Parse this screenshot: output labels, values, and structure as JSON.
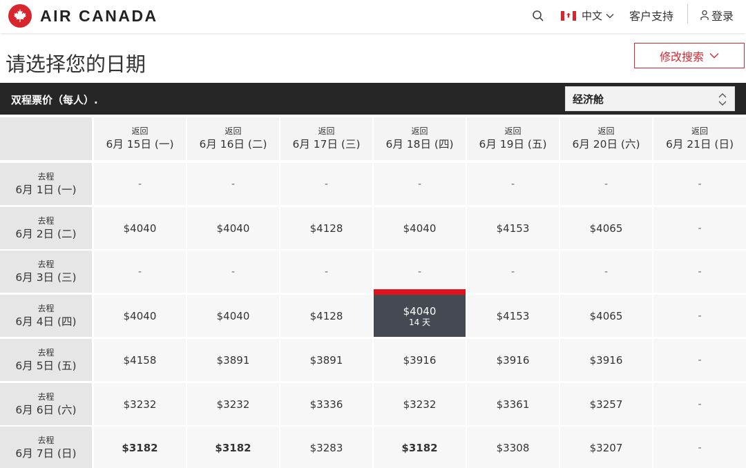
{
  "header": {
    "brand": "AIR CANADA",
    "language": "中文",
    "support": "客户支持",
    "login": "登录",
    "accent_color": "#d8262f"
  },
  "page": {
    "title": "请选择您的日期",
    "modify_search": "修改搜索"
  },
  "bar": {
    "label": "双程票价（每人）.",
    "cabin": "经济舱"
  },
  "grid": {
    "return_label": "返回",
    "depart_label": "去程",
    "columns": [
      "6月 15日 (一)",
      "6月 16日 (二)",
      "6月 17日 (三)",
      "6月 18日 (四)",
      "6月 19日 (五)",
      "6月 20日 (六)",
      "6月 21日 (日)"
    ],
    "rows": [
      {
        "date": "6月 1日 (一)",
        "prices": [
          "-",
          "-",
          "-",
          "-",
          "-",
          "-",
          "-"
        ]
      },
      {
        "date": "6月 2日 (二)",
        "prices": [
          "$4040",
          "$4040",
          "$4128",
          "$4040",
          "$4153",
          "$4065",
          "-"
        ]
      },
      {
        "date": "6月 3日 (三)",
        "prices": [
          "-",
          "-",
          "-",
          "-",
          "-",
          "-",
          "-"
        ]
      },
      {
        "date": "6月 4日 (四)",
        "prices": [
          "$4040",
          "$4040",
          "$4128",
          "$4040",
          "$4153",
          "$4065",
          "-"
        ]
      },
      {
        "date": "6月 5日 (五)",
        "prices": [
          "$4158",
          "$3891",
          "$3891",
          "$3916",
          "$3916",
          "$3916",
          "-"
        ]
      },
      {
        "date": "6月 6日 (六)",
        "prices": [
          "$3232",
          "$3232",
          "$3336",
          "$3232",
          "$3361",
          "$3257",
          "-"
        ]
      },
      {
        "date": "6月 7日 (日)",
        "prices": [
          "$3182",
          "$3182",
          "$3283",
          "$3182",
          "$3308",
          "$3207",
          "-"
        ]
      }
    ],
    "bold_cells": [
      [
        6,
        0
      ],
      [
        6,
        1
      ],
      [
        6,
        3
      ]
    ],
    "selected": {
      "row": 3,
      "col": 3,
      "duration": "14 天"
    }
  }
}
